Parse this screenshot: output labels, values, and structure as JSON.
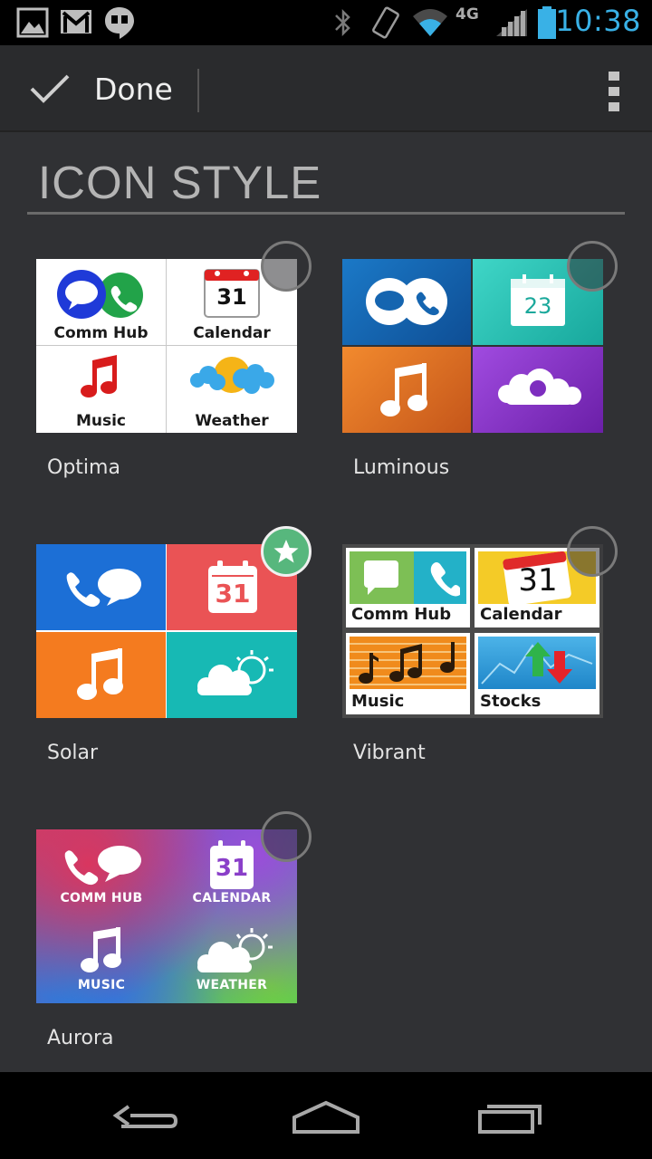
{
  "status_bar": {
    "time": "10:38",
    "network": "4G",
    "icons": [
      "gallery-icon",
      "gmail-icon",
      "hangouts-icon",
      "bluetooth-icon",
      "vibrate-icon",
      "wifi-icon",
      "signal-icon",
      "battery-icon"
    ]
  },
  "action_bar": {
    "done_label": "Done",
    "overflow_icon": "overflow-menu-icon"
  },
  "section": {
    "title": "ICON STYLE"
  },
  "styles": [
    {
      "name": "Optima",
      "selected": false,
      "labels": {
        "comm": "Comm Hub",
        "calendar": "Calendar",
        "music": "Music",
        "weather": "Weather"
      },
      "calendar_day": "31"
    },
    {
      "name": "Luminous",
      "selected": false,
      "calendar_day": "23"
    },
    {
      "name": "Solar",
      "selected": true,
      "calendar_day": "31"
    },
    {
      "name": "Vibrant",
      "selected": false,
      "labels": {
        "comm": "Comm Hub",
        "calendar": "Calendar",
        "music": "Music",
        "stocks": "Stocks"
      },
      "calendar_day": "31"
    },
    {
      "name": "Aurora",
      "selected": false,
      "labels": {
        "comm": "COMM HUB",
        "calendar": "CALENDAR",
        "music": "MUSIC",
        "weather": "WEATHER"
      },
      "calendar_day": "31"
    }
  ],
  "colors": {
    "accent_blue": "#39b1e6",
    "selected_green": "#57b77d",
    "background": "#303134"
  },
  "nav_bar": {
    "icons": [
      "back-icon",
      "home-icon",
      "recents-icon"
    ]
  }
}
